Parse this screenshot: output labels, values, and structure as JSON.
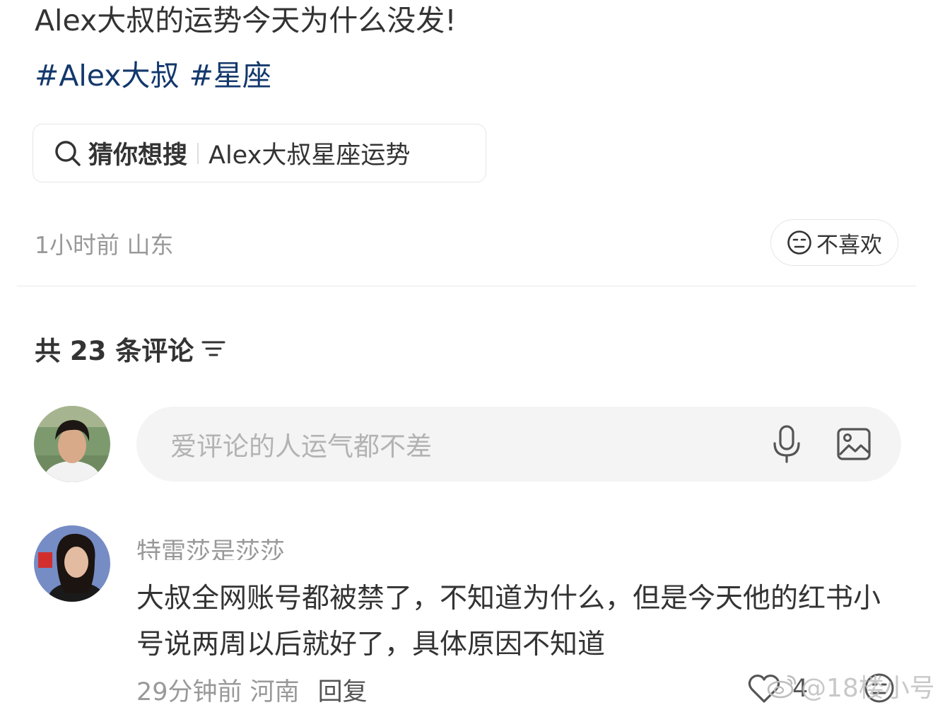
{
  "post": {
    "title": "Alex大叔的运势今天为什么没发!",
    "tags": [
      "#Alex大叔",
      "#星座"
    ],
    "search_suggest": {
      "label": "猜你想搜",
      "query": "Alex大叔星座运势"
    },
    "meta": "1小时前 山东",
    "dislike_label": "不喜欢"
  },
  "comments_section": {
    "count_label": "共 23 条评论",
    "input_placeholder": "爱评论的人运气都不差"
  },
  "comments": [
    {
      "author": "特雷莎是莎莎",
      "text": "大叔全网账号都被禁了，不知道为什么，但是今天他的红书小号说两周以后就好了，具体原因不知道",
      "time_location": "29分钟前 河南",
      "reply_label": "回复",
      "likes": "4"
    }
  ],
  "watermark": "@18楼小号",
  "colors": {
    "tag": "#13386c",
    "text": "#333333",
    "muted": "#999999",
    "input_bg": "#f4f4f5"
  },
  "icons": [
    "search-icon",
    "dislike-face-icon",
    "sort-icon",
    "microphone-icon",
    "image-icon",
    "heart-icon",
    "weibo-logo-icon"
  ]
}
